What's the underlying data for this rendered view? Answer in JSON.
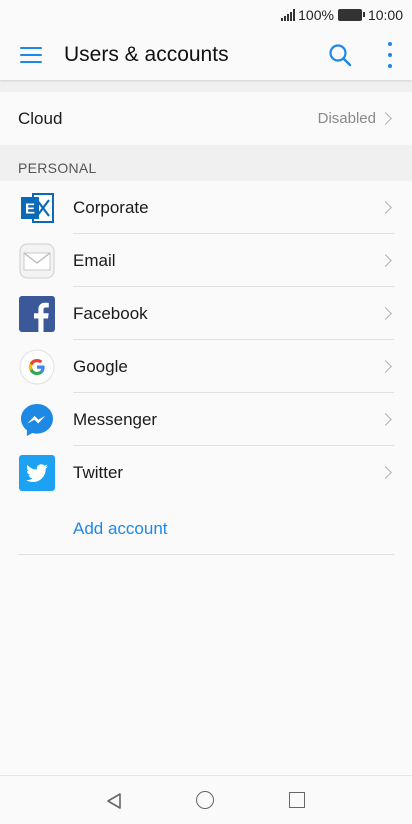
{
  "status_bar": {
    "battery": "100%",
    "time": "10:00"
  },
  "app_bar": {
    "title": "Users & accounts"
  },
  "cloud": {
    "label": "Cloud",
    "value": "Disabled"
  },
  "section": {
    "personal": "PERSONAL"
  },
  "accounts": [
    {
      "label": "Corporate",
      "icon": "exchange-icon"
    },
    {
      "label": "Email",
      "icon": "email-icon"
    },
    {
      "label": "Facebook",
      "icon": "facebook-icon"
    },
    {
      "label": "Google",
      "icon": "google-icon"
    },
    {
      "label": "Messenger",
      "icon": "messenger-icon"
    },
    {
      "label": "Twitter",
      "icon": "twitter-icon"
    }
  ],
  "add_account": {
    "label": "Add account"
  },
  "colors": {
    "accent": "#1e88e5",
    "facebook": "#3b5998",
    "twitter": "#1da1f2",
    "exchange": "#0a6ab8"
  }
}
